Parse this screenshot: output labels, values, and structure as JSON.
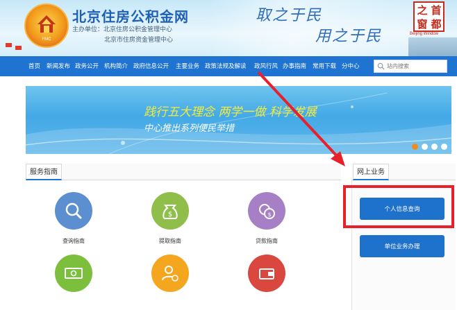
{
  "header": {
    "site_title": "北京住房公积金网",
    "org_line1": "主办单位：北京住房公积金管理中心",
    "org_line2": "北京市住房资金管理中心",
    "slogan_top": "取之于民",
    "slogan_bottom": "用之于民",
    "seal_chars": [
      "之",
      "首",
      "窗",
      "都"
    ],
    "seal_subtitle": "Beijing Window",
    "logo_text": "FMC",
    "brand_color": "#1f74d2"
  },
  "nav": {
    "items": [
      "首页",
      "新闻发布",
      "政务公开",
      "机构简介",
      "政府信息公开",
      "主要业务",
      "政策法规及解读",
      "政风行风",
      "办事指南",
      "常用下载",
      "分中心"
    ],
    "search_placeholder": "站内搜索"
  },
  "banner": {
    "title": "践行五大理念 两学一做 科学发展",
    "subtitle": "中心推出系列便民举措",
    "slide_count": 4,
    "active_slide": 1
  },
  "service_guide": {
    "title": "服务指南",
    "items": [
      {
        "label": "查询指南",
        "icon": "magnifier-icon",
        "color": "#5b8fd0"
      },
      {
        "label": "提取指南",
        "icon": "money-bag-icon",
        "color": "#8fbe4a"
      },
      {
        "label": "贷款指南",
        "icon": "coins-icon",
        "color": "#a77fc4"
      },
      {
        "label": "",
        "icon": "banknote-icon",
        "color": "#7cbf3d"
      },
      {
        "label": "",
        "icon": "person-add-icon",
        "color": "#f3a61e"
      },
      {
        "label": "",
        "icon": "wallet-icon",
        "color": "#d9473f"
      }
    ]
  },
  "online_business": {
    "title": "网上业务",
    "buttons": [
      "个人信息查询",
      "单位业务办理"
    ],
    "highlight_color": "#e8202a"
  }
}
